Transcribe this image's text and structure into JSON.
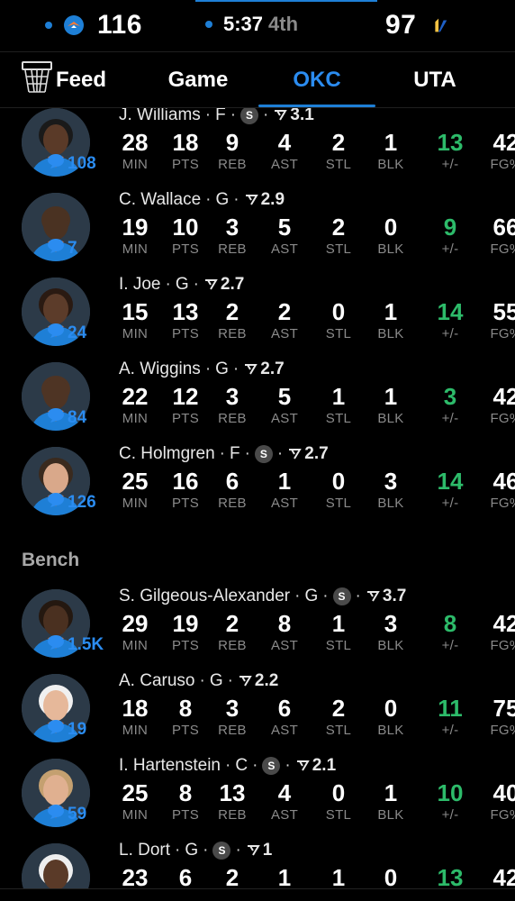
{
  "scoreboard": {
    "home_score": "116",
    "clock": "5:37",
    "period": "4th",
    "away_score": "97",
    "home_logo": "thunder-logo",
    "away_logo": "jazz-logo",
    "accent_color": "#1e7fd6"
  },
  "tabs": [
    {
      "label": "Feed",
      "icon": "basketball-hoop-icon"
    },
    {
      "label": "Game"
    },
    {
      "label": "OKC",
      "active": true
    },
    {
      "label": "UTA"
    }
  ],
  "stat_labels": [
    "MIN",
    "PTS",
    "REB",
    "AST",
    "STL",
    "BLK",
    "+/-",
    "FG%"
  ],
  "bench_title": "Bench",
  "colors": {
    "plus_minus": "#2dbb6a",
    "comments": "#2b8cf0",
    "label": "#8a8a8a"
  },
  "starters": [
    {
      "name": "J. Williams",
      "pos": "F",
      "starter": true,
      "rating": "3.1",
      "comments": "108",
      "stats": [
        "28",
        "18",
        "9",
        "4",
        "2",
        "1",
        "13",
        "42"
      ]
    },
    {
      "name": "C. Wallace",
      "pos": "G",
      "starter": false,
      "rating": "2.9",
      "comments": "7",
      "stats": [
        "19",
        "10",
        "3",
        "5",
        "2",
        "0",
        "9",
        "66"
      ]
    },
    {
      "name": "I. Joe",
      "pos": "G",
      "starter": false,
      "rating": "2.7",
      "comments": "24",
      "stats": [
        "15",
        "13",
        "2",
        "2",
        "0",
        "1",
        "14",
        "55"
      ]
    },
    {
      "name": "A. Wiggins",
      "pos": "G",
      "starter": false,
      "rating": "2.7",
      "comments": "84",
      "stats": [
        "22",
        "12",
        "3",
        "5",
        "1",
        "1",
        "3",
        "42"
      ]
    },
    {
      "name": "C. Holmgren",
      "pos": "F",
      "starter": true,
      "rating": "2.7",
      "comments": "126",
      "stats": [
        "25",
        "16",
        "6",
        "1",
        "0",
        "3",
        "14",
        "46"
      ]
    }
  ],
  "bench": [
    {
      "name": "S. Gilgeous-Alexander",
      "pos": "G",
      "starter": true,
      "rating": "3.7",
      "comments": "1.5K",
      "stats": [
        "29",
        "19",
        "2",
        "8",
        "1",
        "3",
        "8",
        "42"
      ]
    },
    {
      "name": "A. Caruso",
      "pos": "G",
      "starter": false,
      "rating": "2.2",
      "comments": "19",
      "stats": [
        "18",
        "8",
        "3",
        "6",
        "2",
        "0",
        "11",
        "75"
      ]
    },
    {
      "name": "I. Hartenstein",
      "pos": "C",
      "starter": true,
      "rating": "2.1",
      "comments": "59",
      "stats": [
        "25",
        "8",
        "13",
        "4",
        "0",
        "1",
        "10",
        "40"
      ]
    },
    {
      "name": "L. Dort",
      "pos": "G",
      "starter": true,
      "rating": "1",
      "comments": "",
      "stats": [
        "23",
        "6",
        "2",
        "1",
        "1",
        "0",
        "13",
        "42"
      ]
    }
  ]
}
